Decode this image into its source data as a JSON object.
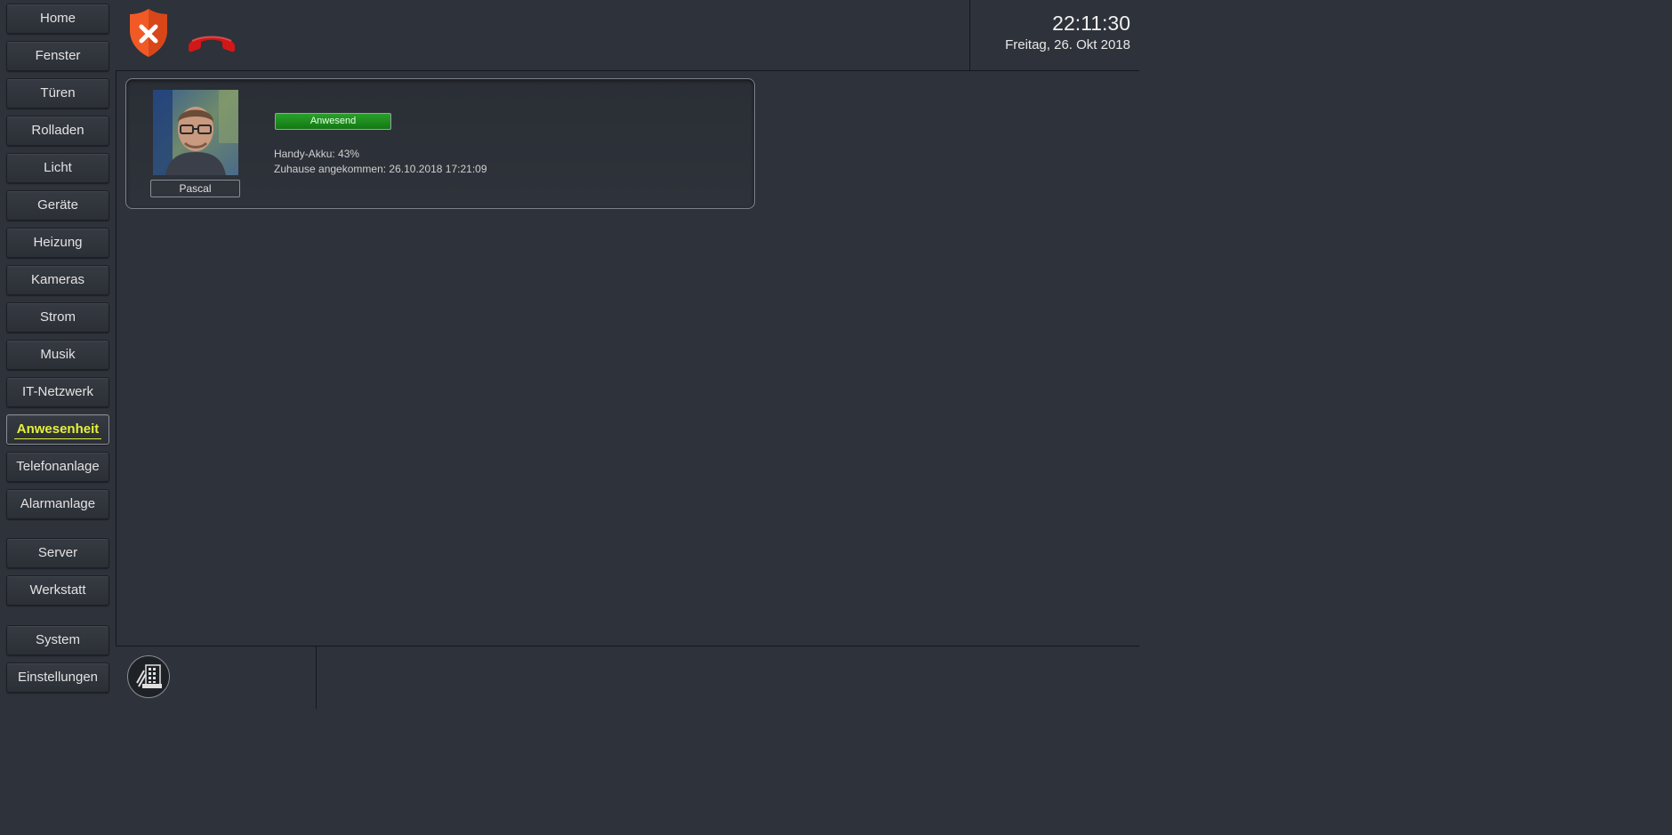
{
  "sidebar": {
    "items": [
      {
        "label": "Home"
      },
      {
        "label": "Fenster"
      },
      {
        "label": "Türen"
      },
      {
        "label": "Rolladen"
      },
      {
        "label": "Licht"
      },
      {
        "label": "Geräte"
      },
      {
        "label": "Heizung"
      },
      {
        "label": "Kameras"
      },
      {
        "label": "Strom"
      },
      {
        "label": "Musik"
      },
      {
        "label": "IT-Netzwerk"
      },
      {
        "label": "Anwesenheit",
        "active": true
      },
      {
        "label": "Telefonanlage"
      },
      {
        "label": "Alarmanlage"
      },
      {
        "label": "Server"
      },
      {
        "label": "Werkstatt"
      },
      {
        "label": "System"
      },
      {
        "label": "Einstellungen"
      }
    ]
  },
  "header": {
    "icons": [
      "security-shield-alert-icon",
      "phone-hangup-icon"
    ],
    "time": "22:11:30",
    "date": "Freitag, 26. Okt 2018"
  },
  "person": {
    "name": "Pascal",
    "status": "Anwesend",
    "battery": "Handy-Akku: 43%",
    "arrived": "Zuhause angekommen: 26.10.2018 17:21:09"
  },
  "footer": {
    "icons": [
      "keypad-icon"
    ]
  },
  "colors": {
    "background": "#2e323a",
    "active_accent": "#e6f23a",
    "status_green": "#1f8c1f",
    "alert_orange": "#f15a24",
    "phone_red": "#d01818"
  }
}
